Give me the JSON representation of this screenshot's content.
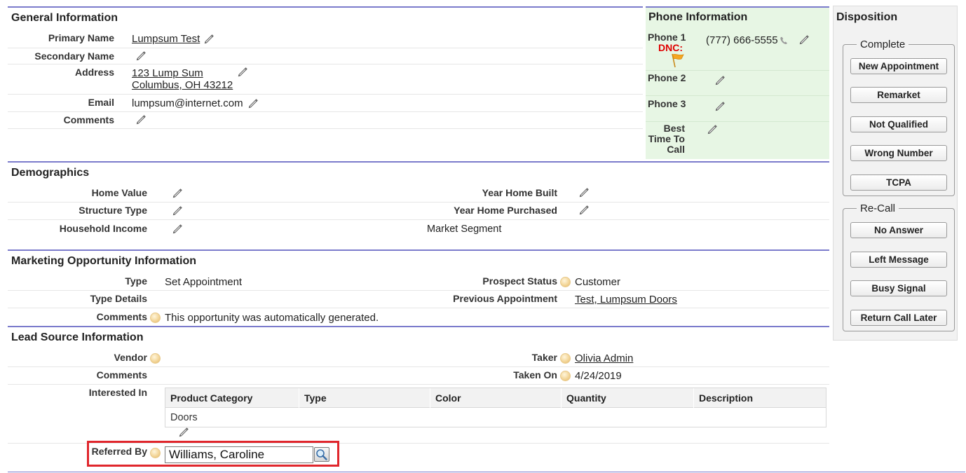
{
  "general": {
    "title": "General Information",
    "primary_name_label": "Primary Name",
    "primary_name": "Lumpsum Test",
    "secondary_name_label": "Secondary Name",
    "address_label": "Address",
    "address_line1": "123 Lump Sum",
    "address_line2": "Columbus, OH 43212",
    "email_label": "Email",
    "email": "lumpsum@internet.com",
    "comments_label": "Comments"
  },
  "phone": {
    "title": "Phone Information",
    "phone1_label": "Phone 1",
    "dnc_label": "DNC:",
    "phone1_value": "(777) 666-5555",
    "phone2_label": "Phone 2",
    "phone3_label": "Phone 3",
    "best_time_line1": "Best",
    "best_time_line2": "Time To",
    "best_time_line3": "Call"
  },
  "disposition": {
    "title": "Disposition",
    "complete_legend": "Complete",
    "complete_buttons": [
      "New Appointment",
      "Remarket",
      "Not Qualified",
      "Wrong Number",
      "TCPA"
    ],
    "recall_legend": "Re-Call",
    "recall_buttons": [
      "No Answer",
      "Left Message",
      "Busy Signal",
      "Return Call Later"
    ]
  },
  "demographics": {
    "title": "Demographics",
    "home_value_label": "Home Value",
    "structure_type_label": "Structure Type",
    "household_income_label": "Household Income",
    "year_built_label": "Year Home Built",
    "year_purchased_label": "Year Home Purchased",
    "market_segment_label": "Market Segment"
  },
  "marketing": {
    "title": "Marketing Opportunity Information",
    "type_label": "Type",
    "type_value": "Set Appointment",
    "type_details_label": "Type Details",
    "comments_label": "Comments",
    "comments_value": "This opportunity was automatically generated.",
    "prospect_status_label": "Prospect Status",
    "prospect_status_value": "Customer",
    "previous_appt_label": "Previous Appointment",
    "previous_appt_value": "Test, Lumpsum Doors"
  },
  "lead_source": {
    "title": "Lead Source Information",
    "vendor_label": "Vendor",
    "comments_label": "Comments",
    "interested_in_label": "Interested In",
    "taker_label": "Taker",
    "taker_value": "Olivia Admin",
    "taken_on_label": "Taken On",
    "taken_on_value": "4/24/2019",
    "table_headers": [
      "Product Category",
      "Type",
      "Color",
      "Quantity",
      "Description"
    ],
    "table_row": [
      "Doors",
      "",
      "",
      "",
      ""
    ],
    "referred_by_label": "Referred By",
    "referred_by_value": "Williams, Caroline"
  },
  "colors": {
    "section_rule": "#7b7bcc",
    "phone_panel_bg": "#e7f6e4",
    "dnc_red": "#e00000",
    "highlight_red": "#e0262c"
  }
}
